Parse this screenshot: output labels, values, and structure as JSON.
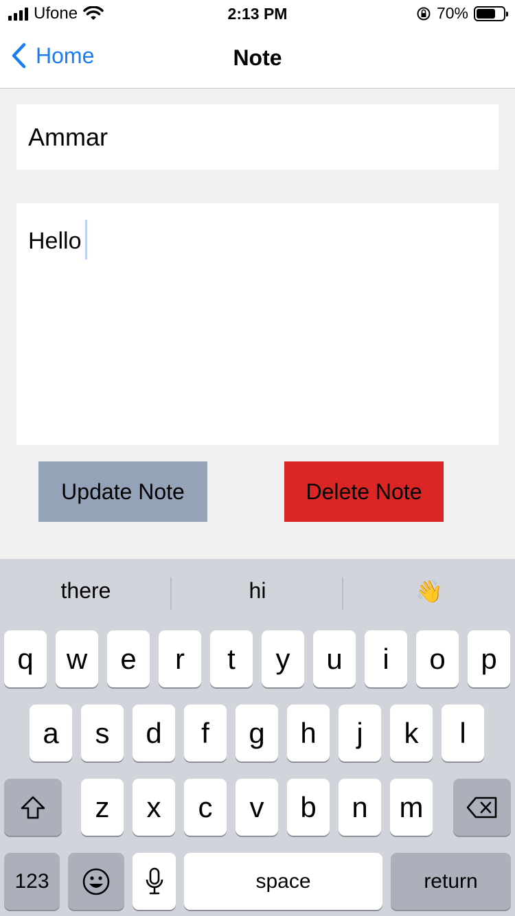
{
  "status_bar": {
    "carrier": "Ufone",
    "time": "2:13 PM",
    "battery": "70%",
    "battery_level": 0.7
  },
  "nav": {
    "back_label": "Home",
    "title": "Note"
  },
  "form": {
    "title_value": "Ammar",
    "body_value": "Hello",
    "update_label": "Update Note",
    "delete_label": "Delete Note"
  },
  "keyboard": {
    "suggestions": [
      "there",
      "hi",
      "👋"
    ],
    "row1": [
      "q",
      "w",
      "e",
      "r",
      "t",
      "y",
      "u",
      "i",
      "o",
      "p"
    ],
    "row2": [
      "a",
      "s",
      "d",
      "f",
      "g",
      "h",
      "j",
      "k",
      "l"
    ],
    "row3": [
      "z",
      "x",
      "c",
      "v",
      "b",
      "n",
      "m"
    ],
    "numbers_label": "123",
    "space_label": "space",
    "return_label": "return"
  },
  "colors": {
    "accent": "#1a7cf2",
    "update_button": "#94a3b7",
    "delete_button": "#dc2626"
  }
}
